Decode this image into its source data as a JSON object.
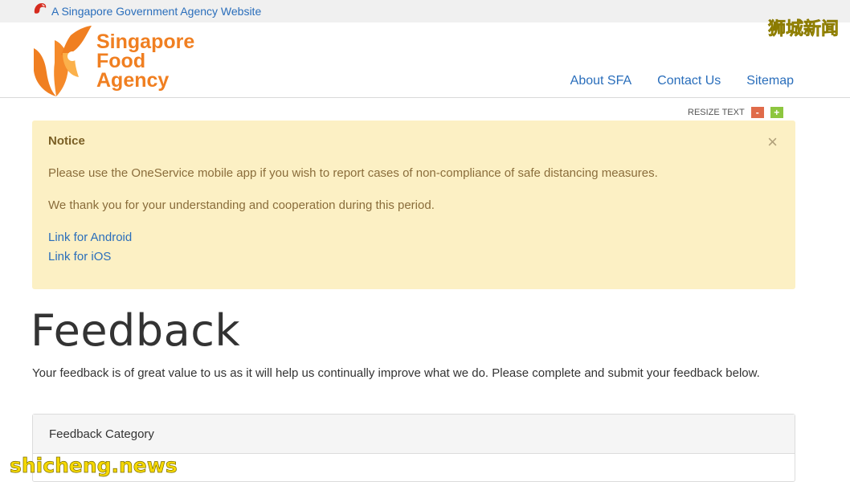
{
  "gov_banner": {
    "text": "A Singapore Government Agency Website"
  },
  "logo": {
    "line1": "Singapore",
    "line2": "Food",
    "line3": "Agency"
  },
  "nav": {
    "items": [
      {
        "label": "About SFA"
      },
      {
        "label": "Contact Us"
      },
      {
        "label": "Sitemap"
      }
    ]
  },
  "resize": {
    "label": "RESIZE TEXT",
    "minus": "-",
    "plus": "+"
  },
  "notice": {
    "title": "Notice",
    "close": "×",
    "line1": "Please use the OneService mobile app if you wish to report cases of non-compliance of safe distancing measures.",
    "line2": "We thank you for your understanding and cooperation during this period.",
    "link_android": "Link for Android",
    "link_ios": "Link for iOS"
  },
  "page": {
    "title": "Feedback",
    "intro": "Your feedback is of great value to us as it will help us continually improve what we do. Please complete and submit your feedback below."
  },
  "panel": {
    "header": "Feedback Category"
  },
  "watermarks": {
    "cn": "狮城新闻",
    "en": "shicheng.news"
  },
  "colors": {
    "brand_orange": "#f07f21",
    "link_blue": "#2a6ebb",
    "notice_bg": "#fcf0c4"
  }
}
